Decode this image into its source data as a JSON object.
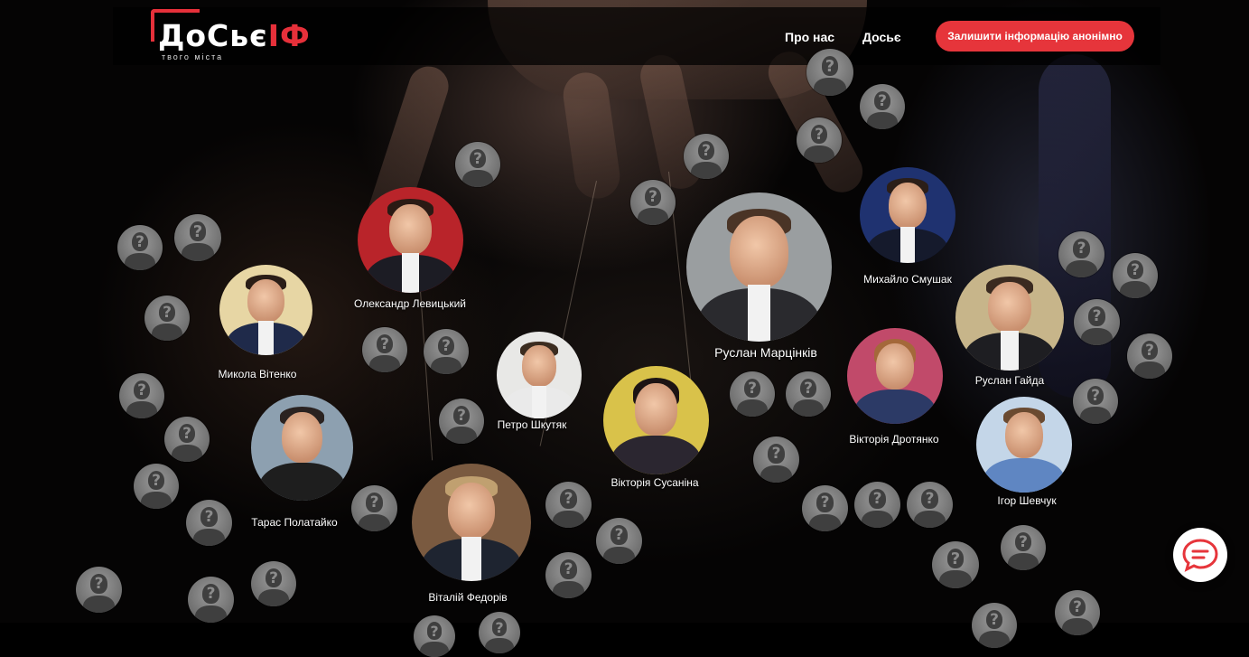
{
  "header": {
    "logo": {
      "text_main": "ДоСьє",
      "text_accent": "ІФ",
      "sub": "твого міста"
    },
    "nav": [
      {
        "label": "Про нас"
      },
      {
        "label": "Досьє"
      }
    ],
    "cta_label": "Залишити інформацію анонімно"
  },
  "people": [
    {
      "name": "Олександр Левицький"
    },
    {
      "name": "Микола Вітенко"
    },
    {
      "name": "Руслан Марцінків"
    },
    {
      "name": "Михайло Смушак"
    },
    {
      "name": "Руслан Гайда"
    },
    {
      "name": "Петро Шкутяк"
    },
    {
      "name": "Вікторія Сусаніна"
    },
    {
      "name": "Вікторія Дротянко"
    },
    {
      "name": "Ігор Шевчук"
    },
    {
      "name": "Тарас Полатайко"
    },
    {
      "name": "Віталій Федорів"
    }
  ],
  "placeholder_glyph": "?",
  "chat_icon": "chat-bubble-icon",
  "colors": {
    "accent": "#e6353b",
    "placeholder": "#8a8a8a"
  }
}
